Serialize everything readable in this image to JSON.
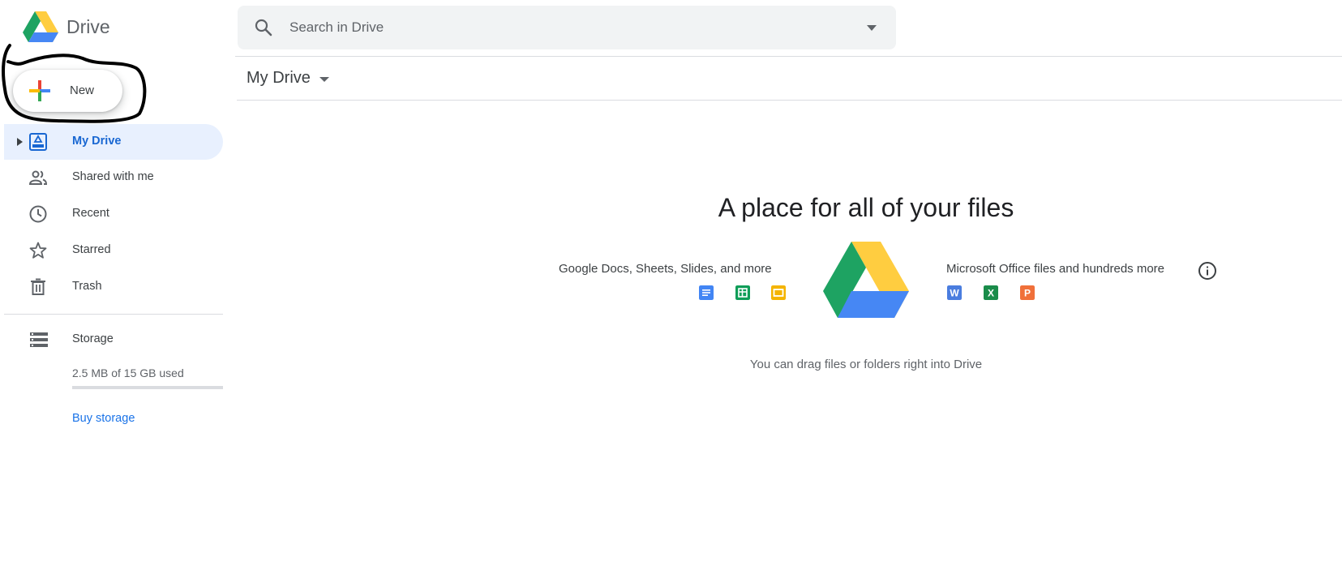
{
  "header": {
    "brand": "Drive",
    "search_placeholder": "Search in Drive"
  },
  "sidebar": {
    "new_label": "New",
    "items": [
      {
        "label": "My Drive",
        "icon": "my-drive-icon",
        "active": true
      },
      {
        "label": "Shared with me",
        "icon": "people-icon",
        "active": false
      },
      {
        "label": "Recent",
        "icon": "clock-icon",
        "active": false
      },
      {
        "label": "Starred",
        "icon": "star-icon",
        "active": false
      },
      {
        "label": "Trash",
        "icon": "trash-icon",
        "active": false
      }
    ],
    "storage": {
      "label": "Storage",
      "used_text": "2.5 MB of 15 GB used",
      "used_fraction": 0.0002,
      "buy_label": "Buy storage"
    }
  },
  "main": {
    "breadcrumb": "My Drive",
    "empty_state": {
      "title": "A place for all of your files",
      "google_text": "Google Docs, Sheets, Slides, and more",
      "ms_text": "Microsoft Office files and hundreds more",
      "hint": "You can drag files or folders right into Drive",
      "google_icons": [
        "docs-icon",
        "sheets-icon",
        "slides-icon"
      ],
      "ms_icons": [
        "word-icon",
        "excel-icon",
        "powerpoint-icon"
      ]
    }
  },
  "colors": {
    "accent_blue": "#1a73e8",
    "active_bg": "#e8f0fe",
    "drive_green": "#1ea362",
    "drive_yellow": "#ffcd40",
    "drive_blue": "#4687f4"
  }
}
